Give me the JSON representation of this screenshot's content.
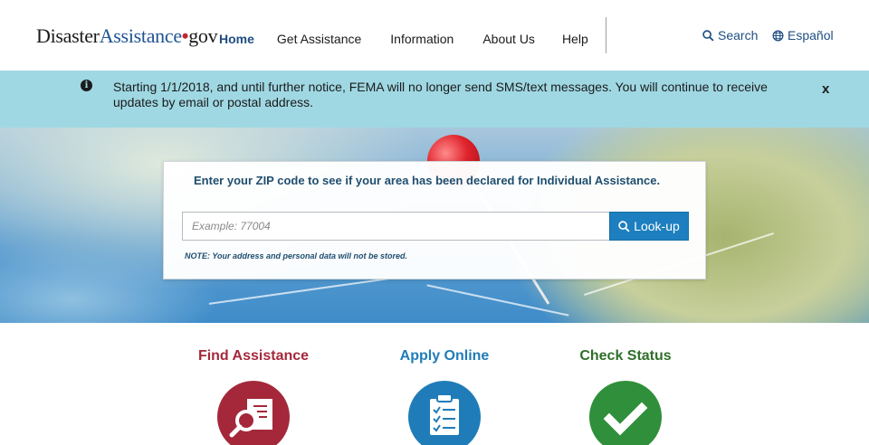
{
  "header": {
    "logo": {
      "part1": "Disaster",
      "part2": "Assistance",
      "dot": "•",
      "part3": "gov"
    },
    "nav": [
      {
        "label": "Home",
        "active": true
      },
      {
        "label": "Get Assistance",
        "active": false
      },
      {
        "label": "Information",
        "active": false
      },
      {
        "label": "About Us",
        "active": false
      },
      {
        "label": "Help",
        "active": false
      }
    ],
    "search_label": "Search",
    "language_label": "Español"
  },
  "alert": {
    "icon": "info-icon",
    "text": "Starting 1/1/2018, and until further notice, FEMA will no longer send SMS/text messages. You will continue to receive updates by email or postal address.",
    "close_label": "x"
  },
  "lookup": {
    "title": "Enter your ZIP code to see if your area has been declared for Individual Assistance.",
    "placeholder": "Example: 77004",
    "button_label": "Look-up",
    "note": "NOTE: Your address and personal data will not be stored."
  },
  "features": [
    {
      "title": "Find Assistance",
      "color": "#a4283a",
      "icon": "find-document-icon"
    },
    {
      "title": "Apply Online",
      "color": "#1f7cb8",
      "icon": "clipboard-checklist-icon"
    },
    {
      "title": "Check Status",
      "color": "#2f8f3a",
      "icon": "checkmark-icon"
    }
  ],
  "colors": {
    "brand_blue": "#205493",
    "alert_bg": "#9fd8e3",
    "button": "#1d7fbf"
  }
}
